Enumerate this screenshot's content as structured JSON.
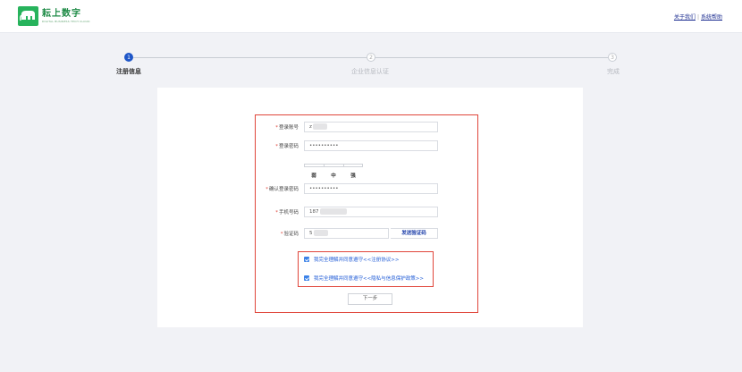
{
  "header": {
    "logo_name": "耘上数字",
    "logo_sub": "DIGITAL BUSINESS TECH CLOUD",
    "links": [
      "关于我们",
      "系统帮助"
    ],
    "separator": "|"
  },
  "steps": [
    {
      "number": "1",
      "label": "注册信息",
      "state": "active"
    },
    {
      "number": "2",
      "label": "企业信息认证",
      "state": "todo"
    },
    {
      "number": "3",
      "label": "完成",
      "state": "todo"
    }
  ],
  "form": {
    "required_mark": "*",
    "account_label": "登录账号",
    "account_value": "z",
    "password_label": "登录密码",
    "password_value": "••••••••••",
    "strength_labels": [
      "弱",
      "中",
      "强"
    ],
    "confirm_label": "确认登录密码",
    "confirm_value": "••••••••••",
    "phone_label": "手机号码",
    "phone_value": "187",
    "code_label": "验证码",
    "code_value": "5",
    "send_code_label": "发送验证码",
    "agree1_text": "我完全理解并同意遵守",
    "agree1_link": "<<注册协议>>",
    "agree2_text": "我完全理解并同意遵守",
    "agree2_link": "<<隐私与信息保护政策>>",
    "next_label": "下一步"
  },
  "colors": {
    "accent": "#1e56c8",
    "brand": "#27b35c",
    "highlight": "#e0453a",
    "link": "#1a2b8f"
  }
}
